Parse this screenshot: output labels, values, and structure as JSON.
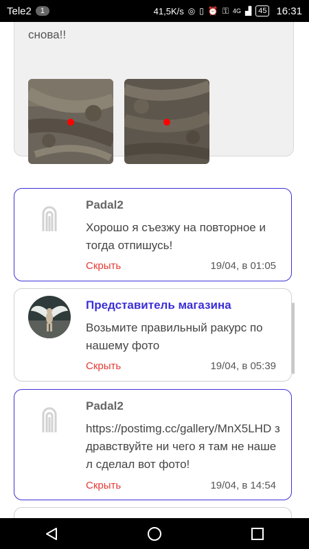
{
  "status_bar": {
    "carrier": "Tele2",
    "sim_badge": "1",
    "speed": "41,5K/s",
    "network": "4G",
    "battery": "45",
    "time": "16:31"
  },
  "top_post": {
    "text_fragment": "снова!!"
  },
  "comments": [
    {
      "author": "Padal2",
      "text": "Хорошо я съезжу на повторное и тогда отпишусь!",
      "hide_label": "Скрыть",
      "time": "19/04, в 01:05"
    },
    {
      "author": "Представитель магазина",
      "text": "Возьмите правильный ракурс по нашему фото",
      "hide_label": "Скрыть",
      "time": "19/04, в 05:39"
    },
    {
      "author": "Padal2",
      "text": "https://postimg.cc/gallery/MnX5LHD здравствуйте ни чего я там не нашел сделал вот фото!",
      "hide_label": "Скрыть",
      "time": "19/04, в 14:54"
    }
  ],
  "colors": {
    "accent": "#3b2fd6",
    "hide": "#e53935",
    "card_bg": "#f0f0f0"
  }
}
